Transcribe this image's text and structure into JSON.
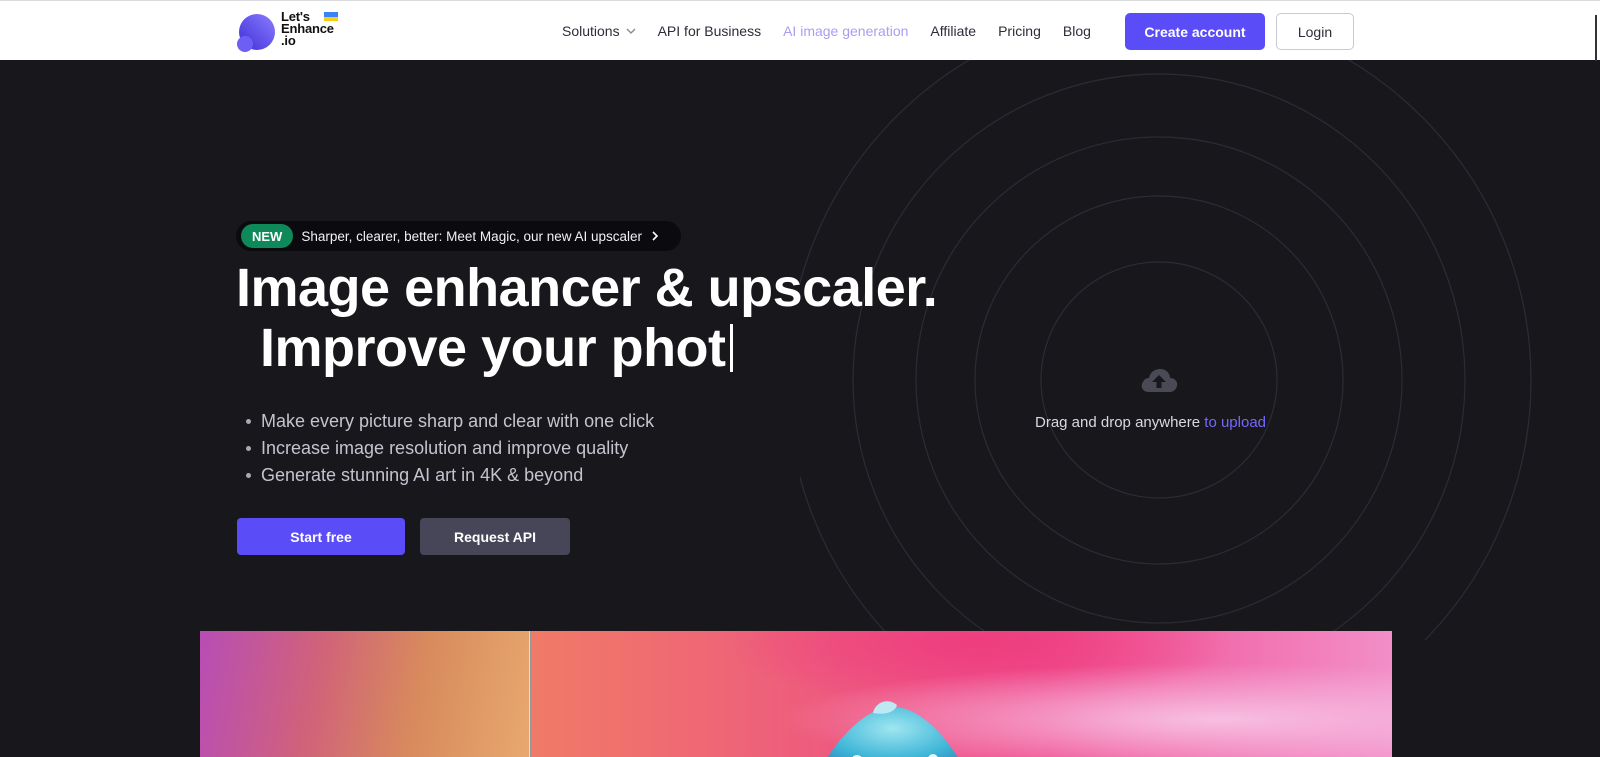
{
  "header": {
    "logo": {
      "line1": "Let's",
      "line2": "Enhance",
      "line3": ".io",
      "icon": "logo-icon",
      "flag_icon": "ukraine-flag-icon"
    },
    "nav": {
      "solutions": "Solutions",
      "api_business": "API for Business",
      "ai_generation": "AI image generation",
      "affiliate": "Affiliate",
      "pricing": "Pricing",
      "blog": "Blog"
    },
    "create_account": "Create account",
    "login": "Login"
  },
  "hero": {
    "badge_label": "NEW",
    "badge_text": "Sharper, clearer, better: Meet Magic, our new AI upscaler",
    "headline_line1": "Image enhancer & upscaler.",
    "headline_line2": "Improve your phot",
    "bullets": [
      "Make every picture sharp and clear with one click",
      "Increase image resolution and improve quality",
      "Generate stunning AI art in 4K & beyond"
    ],
    "start_free": "Start free",
    "request_api": "Request API"
  },
  "upload": {
    "text": "Drag and drop anywhere",
    "link": "to upload",
    "icon": "cloud-upload-icon"
  },
  "colors": {
    "accent": "#5a4cf6",
    "background": "#17171c",
    "new_badge": "#0e8a5a",
    "active_nav": "#a89ef2",
    "upload_link": "#7468ff"
  }
}
